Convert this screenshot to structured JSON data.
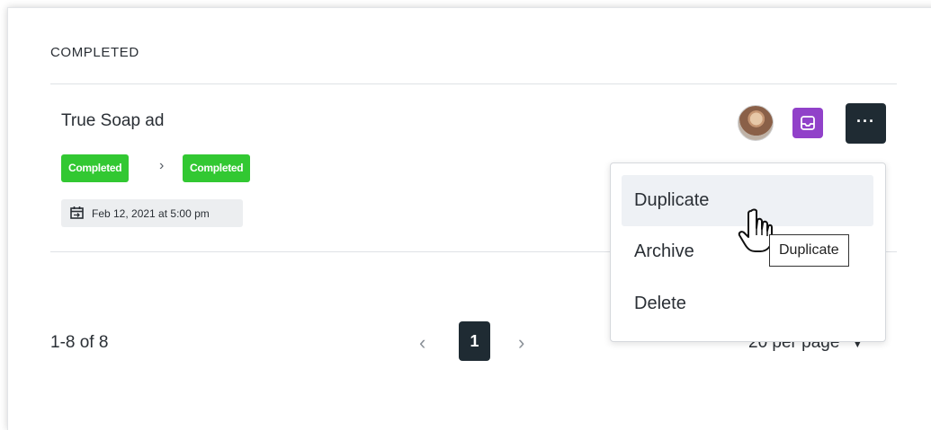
{
  "section": {
    "title": "COMPLETED"
  },
  "card": {
    "title": "True Soap ad",
    "status_from": "Completed",
    "status_to": "Completed",
    "separator": "›",
    "date": "Feb 12, 2021 at 5:00 pm",
    "more_label": "···"
  },
  "pagination": {
    "range": "1-8 of 8",
    "prev": "‹",
    "current_page": "1",
    "next": "›",
    "per_page": "20 per page"
  },
  "menu": {
    "items": [
      {
        "label": "Duplicate"
      },
      {
        "label": "Archive"
      },
      {
        "label": "Delete"
      }
    ]
  },
  "tooltip": {
    "text": "Duplicate"
  },
  "colors": {
    "status_green": "#32c832",
    "inbox_purple": "#9141c9",
    "dark_button": "#1f2b33"
  },
  "icons": {
    "date": "calendar-icon",
    "inbox": "inbox-icon",
    "more": "more-dots-icon",
    "cursor": "hand-pointer-icon"
  }
}
